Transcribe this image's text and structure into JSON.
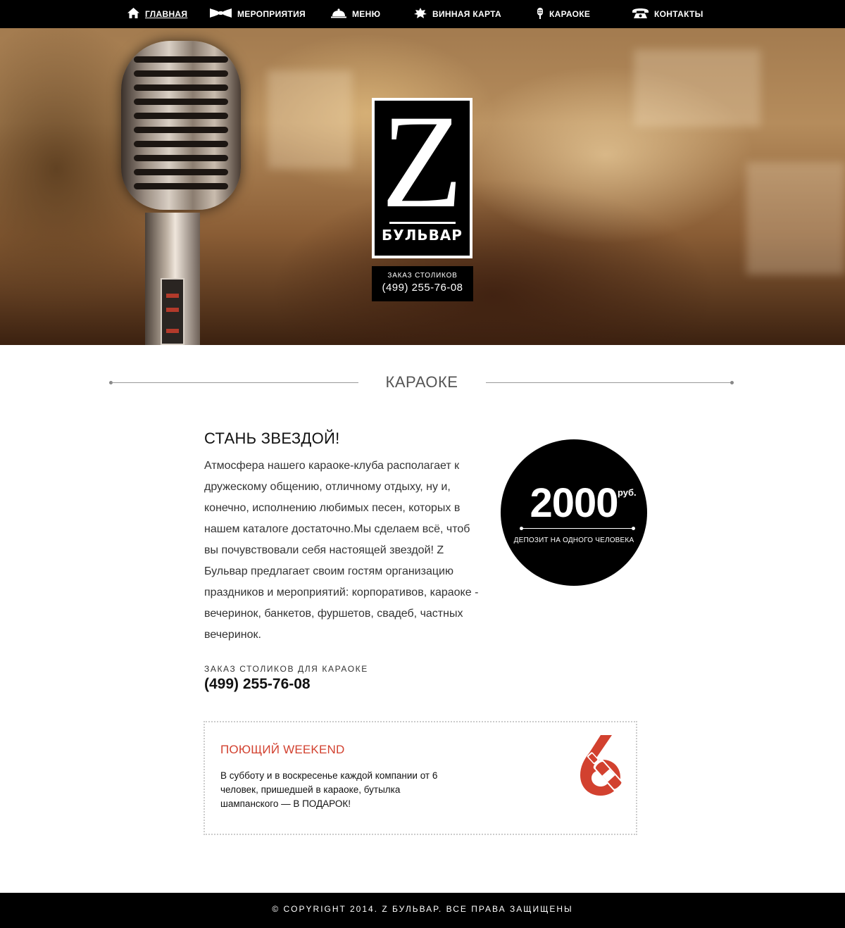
{
  "nav": {
    "items": [
      {
        "label": "Главная",
        "icon": "home-icon",
        "active": true
      },
      {
        "label": "Мероприятия",
        "icon": "bowtie-icon"
      },
      {
        "label": "Меню",
        "icon": "cloche-icon"
      },
      {
        "label": "Винная карта",
        "icon": "grape-leaf-icon"
      },
      {
        "label": "Караоке",
        "icon": "microphone-icon"
      },
      {
        "label": "Контакты",
        "icon": "telephone-icon"
      }
    ]
  },
  "hero": {
    "logo_letter": "Z",
    "logo_subtitle": "БУЛЬВАР",
    "reservation_caption": "Заказ столиков",
    "reservation_phone": "(499) 255-76-08"
  },
  "section": {
    "title": "КАРАОКЕ"
  },
  "content": {
    "heading": "СТАНЬ ЗВЕЗДОЙ!",
    "description": "Атмосфера нашего караоке-клуба располагает к дружескому общению, отличному отдыху, ну и, конечно, исполнению любимых песен, которых в нашем каталоге достаточно.Мы сделаем всё, чтоб вы почувствовали себя настоящей звездой! Z Бульвар предлагает своим гостям организацию праздников и мероприятий: корпоративов, караоке - вечеринок, банкетов, фуршетов, свадеб, частных вечеринок.",
    "reservation_caption": "Заказ столиков для караоке",
    "reservation_phone": "(499) 255-76-08"
  },
  "price_badge": {
    "amount": "2000",
    "currency": "руб.",
    "note": "депозит на одного человека"
  },
  "promo": {
    "title": "Поющий WEEKEND",
    "text": "В субботу и в воскресенье каждой компании от 6 человек, пришедшей в караоке, бутылка шампанского — В ПОДАРОК!",
    "icon": "six-champagne-icon"
  },
  "footer": {
    "copyright": "© Copyright 2014. Z Бульвар. Все права защищены"
  },
  "colors": {
    "accent": "#d2412f",
    "nav_bg": "#000000",
    "footer_bg": "#000000"
  }
}
